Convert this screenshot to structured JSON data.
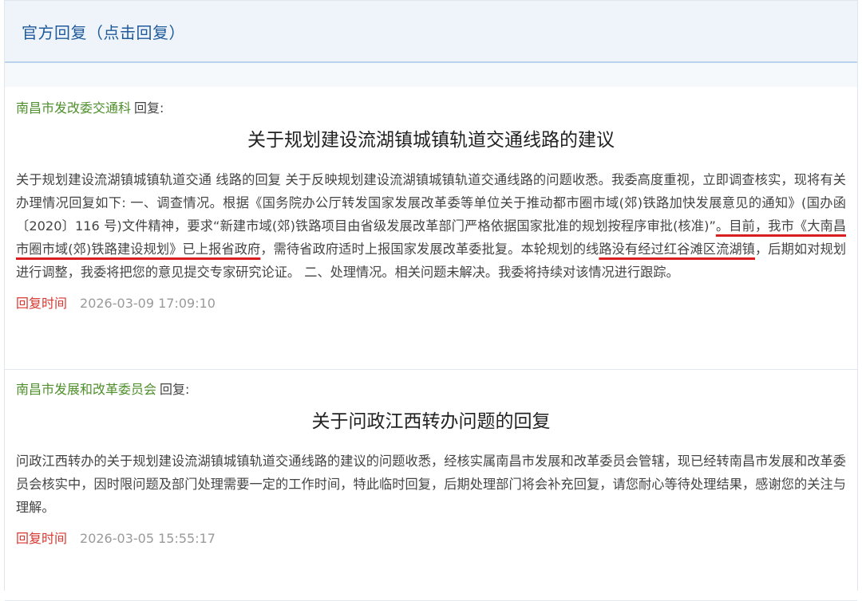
{
  "header": {
    "title": "官方回复（点击回复）"
  },
  "replies": [
    {
      "department": "南昌市发改委交通科",
      "reply_suffix": "回复:",
      "title": "关于规划建设流湖镇城镇轨道交通线路的建议",
      "body_parts": [
        "关于规划建设流湖镇城镇轨道交通 线路的回复 关于反映规划建设流湖镇城镇轨道交通线路的问题收悉。我委高度重视，立即调查核实，现将有关办理情况回复如下: 一、调查情况。根据《国务院办公厅转发国家发展改革委等单位关于推动都市圈市域(郊)铁路加快发展意见的通知》(国办函〔2020〕116 号)文件精神，要求“新建市域(郊)铁路项目由省级发展改革部门严格依据国家批准的规划按程序审批(核准)”",
        "。目前，我市《大南昌市圈市域(郊)铁路建设规划》已上报省政府",
        "，需待省政府适时上报国家发展改革委批复。本轮规划的线",
        "路没有经过红谷滩区流湖镇",
        "，后期如对规划进行调整，我委将把您的意见提交专家研究论证。 二、处理情况。相关问题未解决。我委将持续对该情况进行跟踪。"
      ],
      "time_label": "回复时间",
      "time": "2026-03-09 17:09:10"
    },
    {
      "department": "南昌市发展和改革委员会",
      "reply_suffix": "回复:",
      "title": "关于问政江西转办问题的回复",
      "body": "问政江西转办的关于规划建设流湖镇城镇轨道交通线路的建议的问题收悉，经核实属南昌市发展和改革委员会管辖，现已经转南昌市发展和改革委员会核实中，因时限问题及部门处理需要一定的工作时间，特此临时回复，后期处理部门将会补充回复，请您耐心等待处理结果，感谢您的关注与理解。",
      "time_label": "回复时间",
      "time": "2026-03-05 15:55:17"
    }
  ],
  "colors": {
    "header_bg": "#eef4fa",
    "header_text": "#1e5a9c",
    "department_text": "#4d8f2a",
    "time_label": "#d9372f",
    "underline": "#d81e1e"
  }
}
